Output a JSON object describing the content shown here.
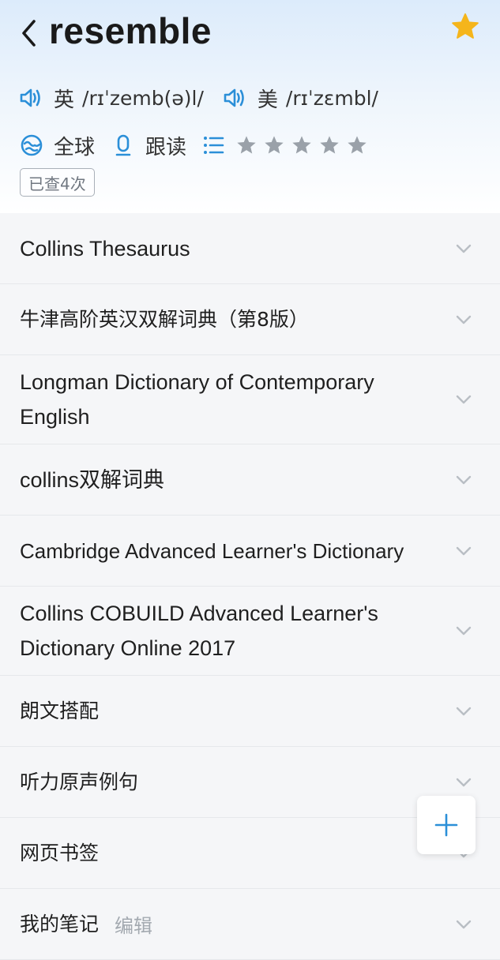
{
  "header": {
    "word": "resemble",
    "pronunciations": [
      {
        "region": "英",
        "phonetic": "/rɪˈzemb(ə)l/"
      },
      {
        "region": "美",
        "phonetic": "/rɪˈzɛmbl/"
      }
    ],
    "tools": {
      "global_label": "全球",
      "follow_read_label": "跟读"
    },
    "rating": {
      "stars_filled": 0,
      "stars_total": 5
    },
    "lookup_count": "已查4次"
  },
  "sections": [
    {
      "label": "Collins Thesaurus"
    },
    {
      "label": "牛津高阶英汉双解词典（第8版）"
    },
    {
      "label": "Longman Dictionary of Contemporary English"
    },
    {
      "label": "collins双解词典"
    },
    {
      "label": "Cambridge Advanced Learner's Dictionary"
    },
    {
      "label": "Collins COBUILD Advanced Learner's Dictionary Online 2017"
    },
    {
      "label": "朗文搭配"
    },
    {
      "label": "听力原声例句"
    },
    {
      "label": "网页书签"
    },
    {
      "label": "我的笔记",
      "action": "编辑"
    }
  ],
  "colors": {
    "accent": "#2b8fd8",
    "favorite_star": "#f5b51b",
    "rating_star": "#9aa1a9"
  },
  "icons": {
    "back": "chevron-left-icon",
    "favorite": "star-icon",
    "speaker": "speaker-icon",
    "global": "globe-icon",
    "mic": "microphone-icon",
    "list": "list-icon",
    "expand": "chevron-down-icon",
    "add": "plus-icon"
  }
}
